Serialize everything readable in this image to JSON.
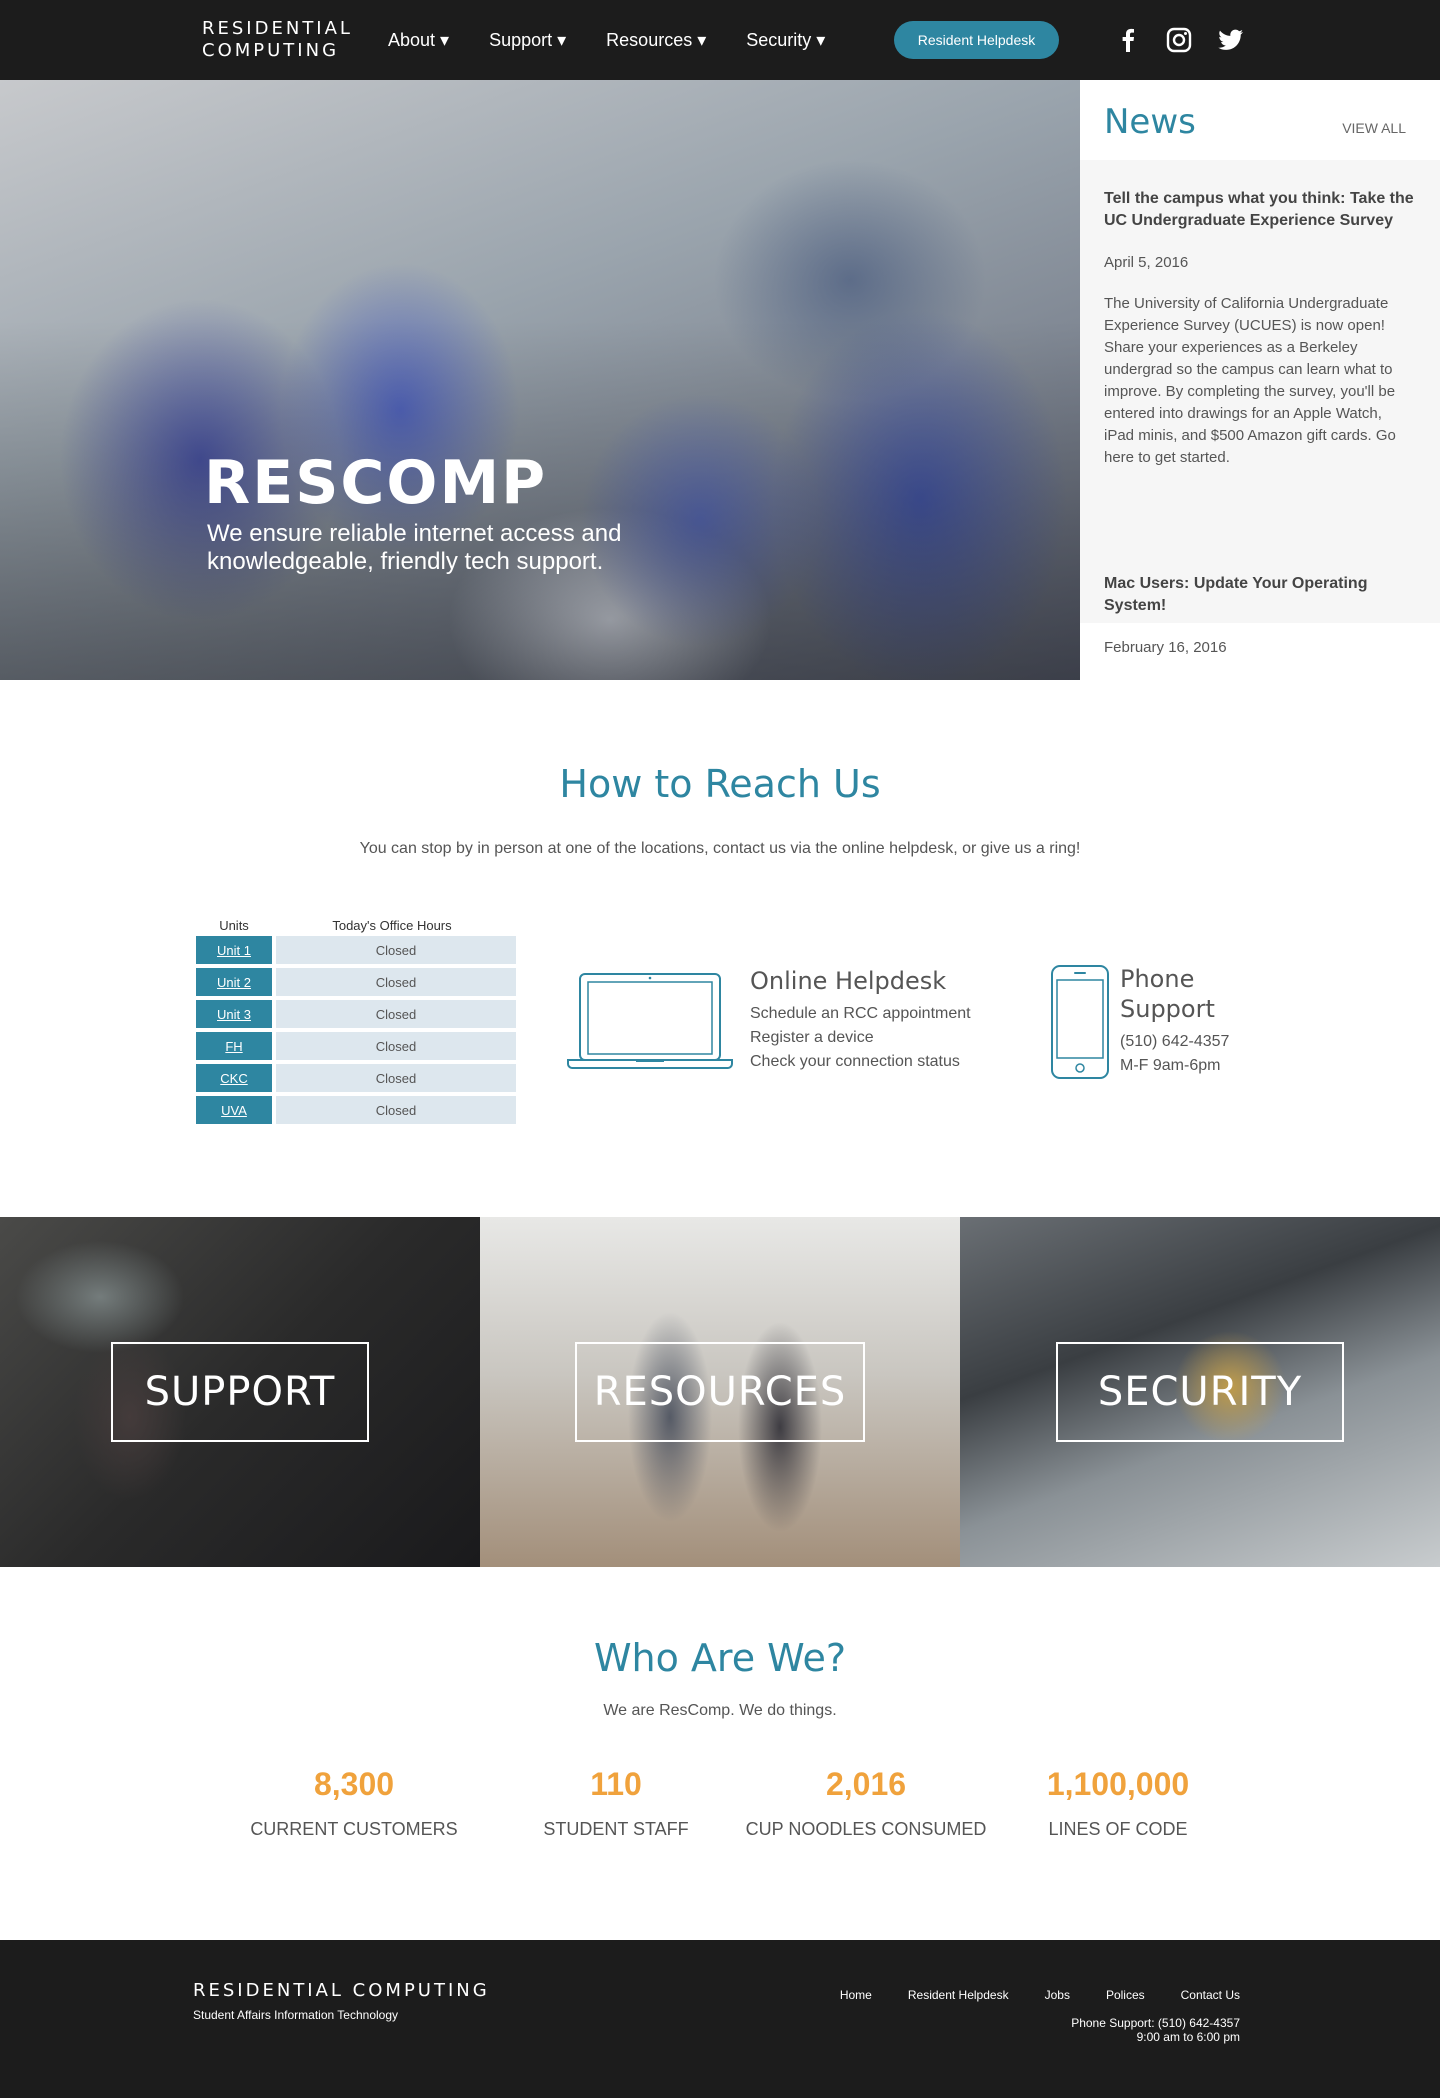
{
  "nav": {
    "logo_line1": "RESIDENTIAL",
    "logo_line2": "COMPUTING",
    "items": [
      {
        "label": "About ▾"
      },
      {
        "label": "Support ▾"
      },
      {
        "label": "Resources ▾"
      },
      {
        "label": "Security ▾"
      }
    ],
    "helpdesk_label": "Resident Helpdesk",
    "social_icons": [
      "facebook-icon",
      "instagram-icon",
      "twitter-icon"
    ]
  },
  "hero": {
    "title": "RESCOMP",
    "subtitle": "We ensure reliable internet access and knowledgeable, friendly tech support."
  },
  "news": {
    "heading": "News",
    "view_all": "VIEW ALL",
    "items": [
      {
        "title": "Tell the campus what you think: Take the UC Undergraduate Experience Survey",
        "date": "April 5, 2016",
        "body": "The University of California Undergraduate Experience Survey (UCUES) is now open! Share your experiences as a Berkeley undergrad so the campus can learn what to improve. By completing the survey, you'll be entered into drawings for an Apple Watch, iPad minis, and $500 Amazon gift cards. Go here to get started."
      },
      {
        "title": "Mac Users: Update Your Operating System!",
        "date": "February 16, 2016"
      }
    ]
  },
  "reach": {
    "title": "How to Reach Us",
    "subtitle": "You can stop by in person at one of the locations, contact us via the online helpdesk, or give us a ring!",
    "hours_table": {
      "col_units": "Units",
      "col_hours": "Today's Office Hours",
      "rows": [
        {
          "unit": "Unit 1",
          "status": "Closed"
        },
        {
          "unit": "Unit 2",
          "status": "Closed"
        },
        {
          "unit": "Unit 3",
          "status": "Closed"
        },
        {
          "unit": "FH",
          "status": "Closed"
        },
        {
          "unit": "CKC",
          "status": "Closed"
        },
        {
          "unit": "UVA",
          "status": "Closed"
        }
      ]
    },
    "helpdesk": {
      "title": "Online Helpdesk",
      "lines": [
        "Schedule an RCC appointment",
        "Register a device",
        "Check your connection status"
      ]
    },
    "phone": {
      "title": "Phone Support",
      "number": "(510) 642-4357",
      "hours": "M-F 9am-6pm"
    }
  },
  "tiles": [
    {
      "label": "SUPPORT"
    },
    {
      "label": "RESOURCES"
    },
    {
      "label": "SECURITY"
    }
  ],
  "who": {
    "title": "Who Are We?",
    "subtitle": "We are ResComp. We do things.",
    "stats": [
      {
        "value": "8,300",
        "label": "CURRENT CUSTOMERS"
      },
      {
        "value": "110",
        "label": "STUDENT STAFF"
      },
      {
        "value": "2,016",
        "label": "CUP NOODLES CONSUMED"
      },
      {
        "value": "1,100,000",
        "label": "LINES OF CODE"
      }
    ]
  },
  "footer": {
    "logo": "RESIDENTIAL COMPUTING",
    "tagline": "Student Affairs Information Technology",
    "links": [
      "Home",
      "Resident Helpdesk",
      "Jobs",
      "Polices",
      "Contact Us"
    ],
    "phone_line": "Phone Support: (510) 642-4357",
    "hours_line": "9:00 am to 6:00 pm"
  },
  "colors": {
    "brand_teal": "#2e86a1",
    "accent_orange": "#f0a23c",
    "nav_background": "#1c1c1c"
  }
}
